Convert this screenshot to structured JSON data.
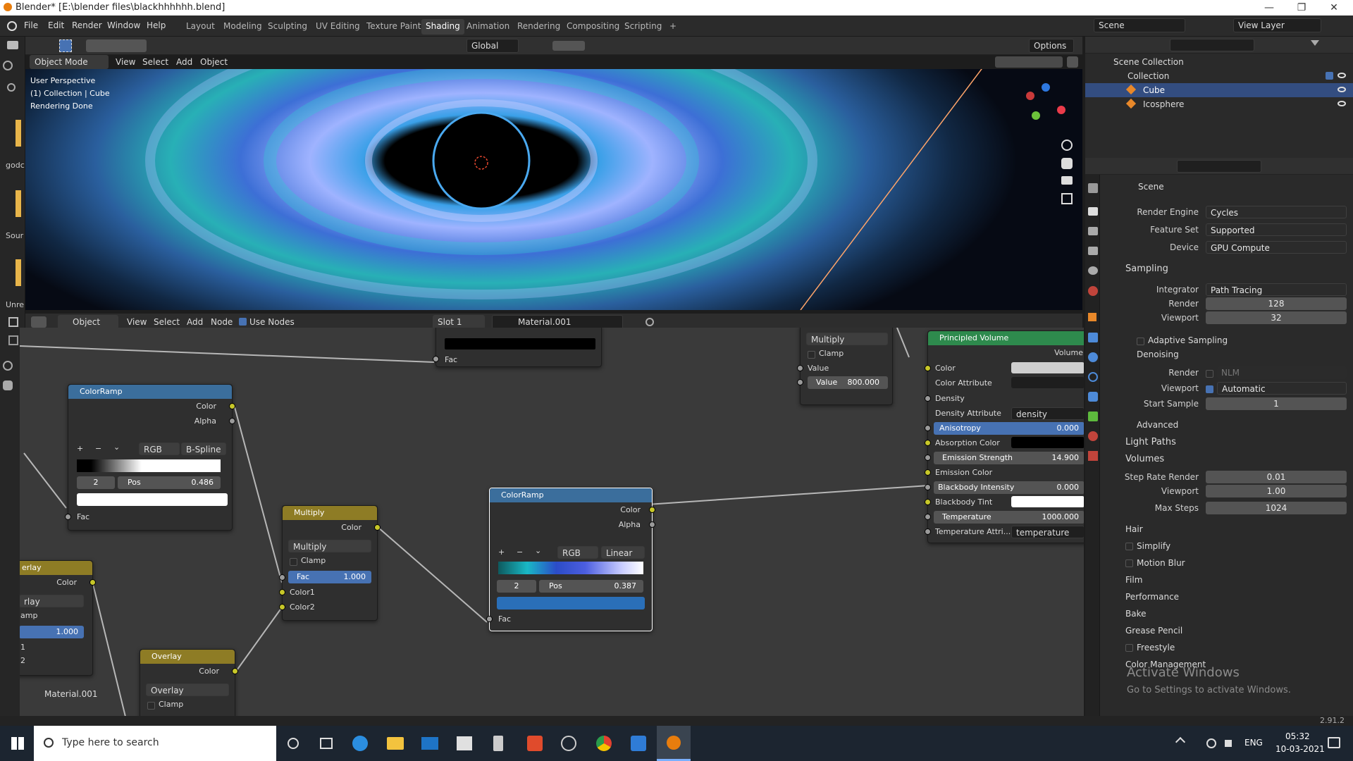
{
  "window": {
    "title": "Blender* [E:\\blender files\\blackhhhhhh.blend]",
    "minimize": "—",
    "maximize": "❐",
    "close": "✕"
  },
  "menus": [
    "File",
    "Edit",
    "Render",
    "Window",
    "Help"
  ],
  "workspaces": [
    "Layout",
    "Modeling",
    "Sculpting",
    "UV Editing",
    "Texture Paint",
    "Shading",
    "Animation",
    "Rendering",
    "Compositing",
    "Scripting"
  ],
  "workspace_active": "Shading",
  "add_workspace": "+",
  "scene": {
    "label": "Scene",
    "view_layer": "View Layer"
  },
  "viewport_header": {
    "mode": "Object Mode",
    "view": "View",
    "select": "Select",
    "add": "Add",
    "object": "Object",
    "transform": "Global",
    "options": "Options"
  },
  "viewport_overlay": {
    "line1": "User Perspective",
    "line2": "(1) Collection | Cube",
    "line3": "Rendering Done"
  },
  "side_labels": [
    "godc",
    "Sour",
    "Unre"
  ],
  "node_header": {
    "object": "Object",
    "view": "View",
    "select": "Select",
    "add": "Add",
    "node": "Node",
    "use_nodes": "Use Nodes",
    "slot": "Slot 1",
    "material": "Material.001"
  },
  "nodes": {
    "top_fac": "Fac",
    "math": {
      "op": "Multiply",
      "clamp": "Clamp",
      "value": "Value",
      "value_field": "Value",
      "value_num": "800.000"
    },
    "colorramp1": {
      "title": "ColorRamp",
      "color": "Color",
      "alpha": "Alpha",
      "mode": "RGB",
      "interp": "B-Spline",
      "index": "2",
      "pos_label": "Pos",
      "pos": "0.486",
      "fac": "Fac",
      "plus": "+",
      "minus": "−",
      "chevron": "⌄"
    },
    "multiply": {
      "title": "Multiply",
      "color": "Color",
      "op": "Multiply",
      "clamp": "Clamp",
      "fac_label": "Fac",
      "fac": "1.000",
      "color1": "Color1",
      "color2": "Color2"
    },
    "colorramp2": {
      "title": "ColorRamp",
      "color": "Color",
      "alpha": "Alpha",
      "mode": "RGB",
      "interp": "Linear",
      "index": "2",
      "pos_label": "Pos",
      "pos": "0.387",
      "fac": "Fac",
      "plus": "+",
      "minus": "−",
      "chevron": "⌄"
    },
    "overlay_left": {
      "title": "erlay",
      "color": "Color",
      "op": "rlay",
      "clamp": "amp",
      "fac": "1.000",
      "c1": "1",
      "c2": "2"
    },
    "overlay2": {
      "title": "Overlay",
      "color": "Color",
      "op": "Overlay",
      "clamp": "Clamp"
    },
    "material_label": "Material.001",
    "principled": {
      "title": "Principled Volume",
      "volume": "Volume",
      "color": "Color",
      "color_attr": "Color Attribute",
      "density": "Density",
      "density_attr": "Density Attribute",
      "density_attr_val": "density",
      "anisotropy": "Anisotropy",
      "anisotropy_val": "0.000",
      "absorption": "Absorption Color",
      "emission_strength": "Emission Strength",
      "emission_strength_val": "14.900",
      "emission_color": "Emission Color",
      "bb_intensity": "Blackbody Intensity",
      "bb_intensity_val": "0.000",
      "bb_tint": "Blackbody Tint",
      "temperature": "Temperature",
      "temperature_val": "1000.000",
      "temp_attr": "Temperature Attri...",
      "temp_attr_val": "temperature"
    }
  },
  "outliner": {
    "scene_collection": "Scene Collection",
    "collection": "Collection",
    "items": [
      "Cube",
      "Icosphere"
    ]
  },
  "properties": {
    "scene": "Scene",
    "render_engine_label": "Render Engine",
    "render_engine": "Cycles",
    "feature_set_label": "Feature Set",
    "feature_set": "Supported",
    "device_label": "Device",
    "device": "GPU Compute",
    "sampling": "Sampling",
    "integrator_label": "Integrator",
    "integrator": "Path Tracing",
    "render_label": "Render",
    "render": "128",
    "viewport_label": "Viewport",
    "viewport": "32",
    "adaptive": "Adaptive Sampling",
    "denoising": "Denoising",
    "dn_render_label": "Render",
    "dn_render": "NLM",
    "dn_viewport_label": "Viewport",
    "dn_viewport": "Automatic",
    "start_sample_label": "Start Sample",
    "start_sample": "1",
    "advanced": "Advanced",
    "light_paths": "Light Paths",
    "volumes": "Volumes",
    "step_rate_label": "Step Rate Render",
    "step_rate": "0.01",
    "vol_viewport_label": "Viewport",
    "vol_viewport": "1.00",
    "max_steps_label": "Max Steps",
    "max_steps": "1024",
    "hair": "Hair",
    "simplify": "Simplify",
    "motion_blur": "Motion Blur",
    "film": "Film",
    "performance": "Performance",
    "bake": "Bake",
    "grease_pencil": "Grease Pencil",
    "freestyle": "Freestyle",
    "color_management": "Color Management"
  },
  "watermark": {
    "line1": "Activate Windows",
    "line2": "Go to Settings to activate Windows."
  },
  "version": "2.91.2",
  "taskbar": {
    "search": "Type here to search",
    "lang": "ENG",
    "time": "05:32",
    "date": "10-03-2021"
  }
}
